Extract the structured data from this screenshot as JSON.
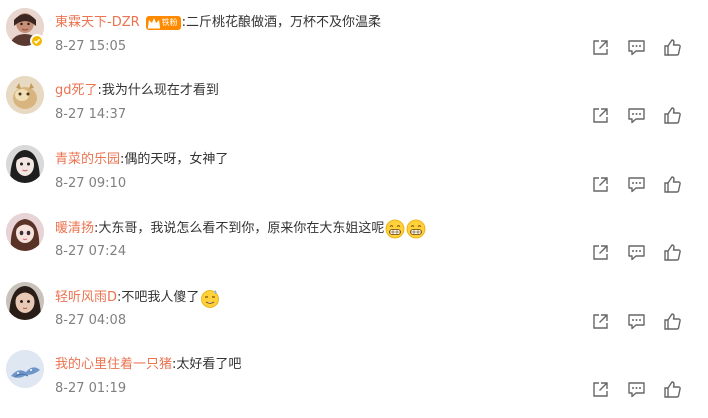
{
  "comments": [
    {
      "username": "東霖天下-DZR",
      "badge": "铁粉",
      "text": "二斤桃花酿做酒，万杯不及你温柔",
      "time": "8-27 15:05"
    },
    {
      "username": "gd死了",
      "text": "我为什么现在才看到",
      "time": "8-27 14:37"
    },
    {
      "username": "青菜的乐园",
      "text": "偶的天呀，女神了",
      "time": "8-27 09:10"
    },
    {
      "username": "暖清扬",
      "text": "大东哥，我说怎么看不到你，原来你在大东姐这呢",
      "time": "8-27 07:24"
    },
    {
      "username": "轻听风雨D",
      "text": "不吧我人傻了",
      "time": "8-27 04:08"
    },
    {
      "username": "我的心里住着一只猪",
      "text": "太好看了吧",
      "time": "8-27 01:19"
    }
  ],
  "colors": {
    "username": "#eb7350",
    "text": "#333333",
    "time": "#808080",
    "icon": "#666666",
    "badge": "#ff8a00"
  },
  "icons": [
    "share-icon",
    "comment-icon",
    "like-icon"
  ]
}
